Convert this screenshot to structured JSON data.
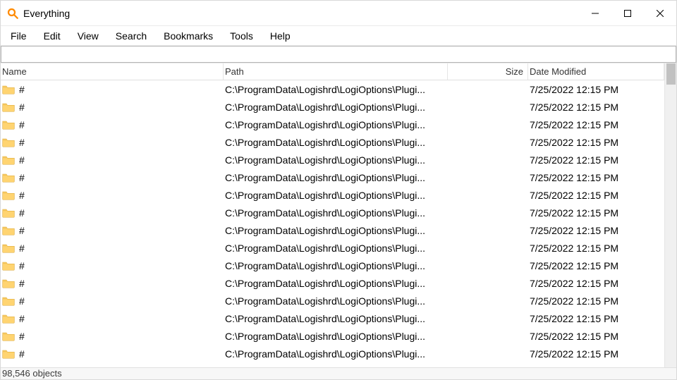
{
  "window": {
    "title": "Everything"
  },
  "menu": {
    "items": [
      {
        "label": "File"
      },
      {
        "label": "Edit"
      },
      {
        "label": "View"
      },
      {
        "label": "Search"
      },
      {
        "label": "Bookmarks"
      },
      {
        "label": "Tools"
      },
      {
        "label": "Help"
      }
    ]
  },
  "search": {
    "value": ""
  },
  "columns": {
    "name": "Name",
    "path": "Path",
    "size": "Size",
    "date": "Date Modified"
  },
  "rows": [
    {
      "name": "#",
      "path": "C:\\ProgramData\\Logishrd\\LogiOptions\\Plugi...",
      "size": "",
      "date": "7/25/2022 12:15 PM"
    },
    {
      "name": "#",
      "path": "C:\\ProgramData\\Logishrd\\LogiOptions\\Plugi...",
      "size": "",
      "date": "7/25/2022 12:15 PM"
    },
    {
      "name": "#",
      "path": "C:\\ProgramData\\Logishrd\\LogiOptions\\Plugi...",
      "size": "",
      "date": "7/25/2022 12:15 PM"
    },
    {
      "name": "#",
      "path": "C:\\ProgramData\\Logishrd\\LogiOptions\\Plugi...",
      "size": "",
      "date": "7/25/2022 12:15 PM"
    },
    {
      "name": "#",
      "path": "C:\\ProgramData\\Logishrd\\LogiOptions\\Plugi...",
      "size": "",
      "date": "7/25/2022 12:15 PM"
    },
    {
      "name": "#",
      "path": "C:\\ProgramData\\Logishrd\\LogiOptions\\Plugi...",
      "size": "",
      "date": "7/25/2022 12:15 PM"
    },
    {
      "name": "#",
      "path": "C:\\ProgramData\\Logishrd\\LogiOptions\\Plugi...",
      "size": "",
      "date": "7/25/2022 12:15 PM"
    },
    {
      "name": "#",
      "path": "C:\\ProgramData\\Logishrd\\LogiOptions\\Plugi...",
      "size": "",
      "date": "7/25/2022 12:15 PM"
    },
    {
      "name": "#",
      "path": "C:\\ProgramData\\Logishrd\\LogiOptions\\Plugi...",
      "size": "",
      "date": "7/25/2022 12:15 PM"
    },
    {
      "name": "#",
      "path": "C:\\ProgramData\\Logishrd\\LogiOptions\\Plugi...",
      "size": "",
      "date": "7/25/2022 12:15 PM"
    },
    {
      "name": "#",
      "path": "C:\\ProgramData\\Logishrd\\LogiOptions\\Plugi...",
      "size": "",
      "date": "7/25/2022 12:15 PM"
    },
    {
      "name": "#",
      "path": "C:\\ProgramData\\Logishrd\\LogiOptions\\Plugi...",
      "size": "",
      "date": "7/25/2022 12:15 PM"
    },
    {
      "name": "#",
      "path": "C:\\ProgramData\\Logishrd\\LogiOptions\\Plugi...",
      "size": "",
      "date": "7/25/2022 12:15 PM"
    },
    {
      "name": "#",
      "path": "C:\\ProgramData\\Logishrd\\LogiOptions\\Plugi...",
      "size": "",
      "date": "7/25/2022 12:15 PM"
    },
    {
      "name": "#",
      "path": "C:\\ProgramData\\Logishrd\\LogiOptions\\Plugi...",
      "size": "",
      "date": "7/25/2022 12:15 PM"
    },
    {
      "name": "#",
      "path": "C:\\ProgramData\\Logishrd\\LogiOptions\\Plugi...",
      "size": "",
      "date": "7/25/2022 12:15 PM"
    }
  ],
  "status": {
    "text": "98,546 objects"
  },
  "colors": {
    "accent": "#ff8a00"
  }
}
